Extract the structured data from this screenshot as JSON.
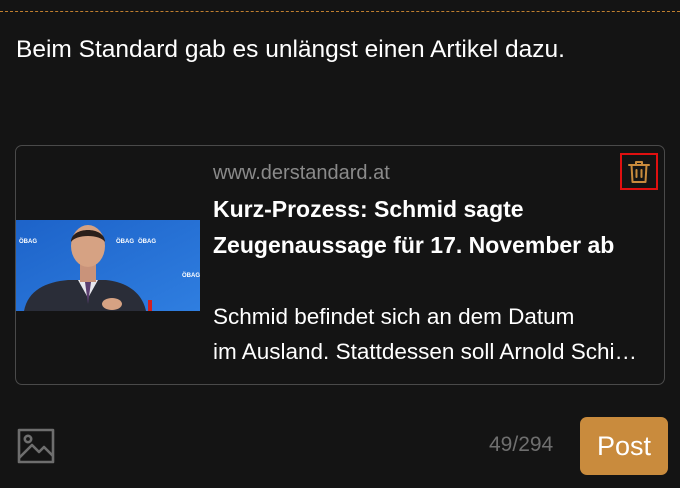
{
  "post": {
    "text": "Beim Standard gab es unlängst einen Artikel dazu."
  },
  "link_preview": {
    "domain": "www.derstandard.at",
    "title": "Kurz-Prozess: Schmid sagte Zeugenaussage für 17. November ab",
    "description_line1": "Schmid befindet sich an dem Datum",
    "description_line2": "im Ausland. Stattdessen soll Arnold Schiefer nachgeholt werden",
    "thumbnail_logo_text": "ÖBAG",
    "delete_icon": "trash-icon"
  },
  "composer": {
    "image_icon": "image-icon",
    "char_count": "49/294",
    "post_label": "Post"
  },
  "colors": {
    "background": "#141414",
    "accent": "#c98b3d",
    "highlight_border": "#e01010",
    "muted_text": "#8a8a8a"
  }
}
